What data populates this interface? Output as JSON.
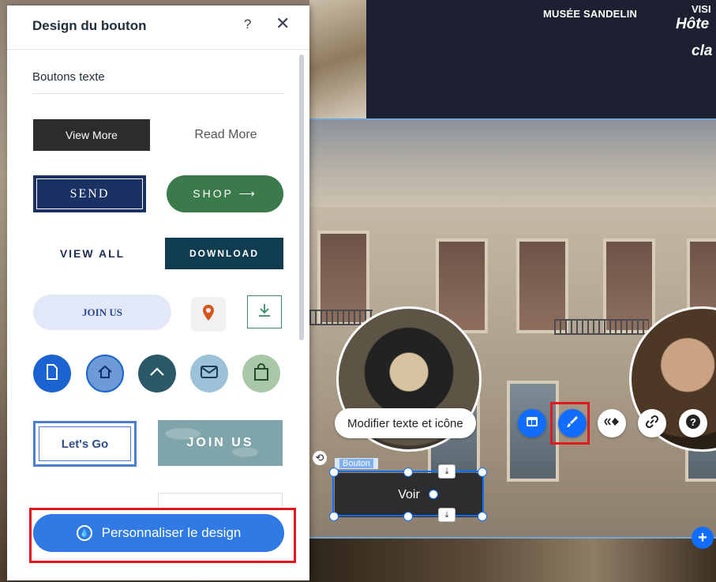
{
  "panel": {
    "title": "Design du bouton",
    "help": "?",
    "close": "✕",
    "section_label": "Boutons texte",
    "presets": {
      "view_more": "View More",
      "read_more": "Read More",
      "send": "SEND",
      "shop": "SHOP ⟶",
      "view_all": "VIEW ALL",
      "download": "DOWNLOAD",
      "join_us": "JOIN US",
      "lets_go": "Let's Go",
      "join_us_pattern": "JOIN US"
    },
    "customize_label": "Personnaliser le design",
    "customize_icon": "droplet-icon"
  },
  "site": {
    "nav_item_1": "MUSÉE SANDELIN",
    "nav_item_2": "VISI",
    "hero_line_1": "Hôte",
    "hero_line_2": "cla",
    "edit_text_label": "Modifier texte et icône",
    "selection_label": "Bouton",
    "button_text": "Voir",
    "add_label": "+"
  },
  "colors": {
    "accent": "#116dff",
    "highlight": "#e0191f",
    "customize_button": "#2f7ae5"
  }
}
